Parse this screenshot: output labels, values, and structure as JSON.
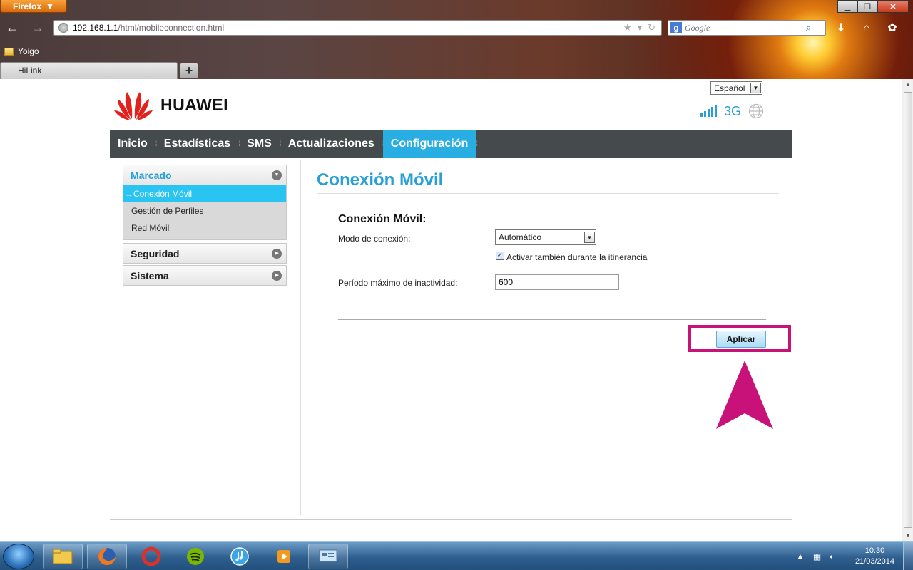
{
  "browser": {
    "menu_label": "Firefox",
    "url_host": "192.168.1.1",
    "url_path": "/html/mobileconnection.html",
    "search_placeholder": "Google",
    "bookmark_label": "Yoigo",
    "tab_label": "HiLink",
    "new_tab_label": "+"
  },
  "header": {
    "brand": "HUAWEI",
    "language": "Español",
    "network_type": "3G"
  },
  "nav": {
    "items": [
      {
        "label": "Inicio"
      },
      {
        "label": "Estadísticas"
      },
      {
        "label": "SMS"
      },
      {
        "label": "Actualizaciones"
      },
      {
        "label": "Configuración"
      }
    ],
    "active_index": 4
  },
  "sidebar": {
    "sections": [
      {
        "label": "Marcado",
        "items": [
          "Conexión Móvil",
          "Gestión de Perfiles",
          "Red Móvil"
        ]
      },
      {
        "label": "Seguridad"
      },
      {
        "label": "Sistema"
      }
    ],
    "active_item": "Conexión Móvil"
  },
  "content": {
    "title": "Conexión Móvil",
    "section_heading": "Conexión Móvil:",
    "mode_label": "Modo de conexión:",
    "mode_value": "Automático",
    "roaming_label": "Activar también durante la itinerancia",
    "roaming_checked": true,
    "idle_label": "Período máximo de inactividad:",
    "idle_value": "600",
    "apply_label": "Aplicar"
  },
  "taskbar": {
    "time": "10:30",
    "date": "21/03/2014"
  },
  "colors": {
    "accent": "#29aee4",
    "nav_bg": "#454a4d",
    "annotation": "#c8127a"
  }
}
